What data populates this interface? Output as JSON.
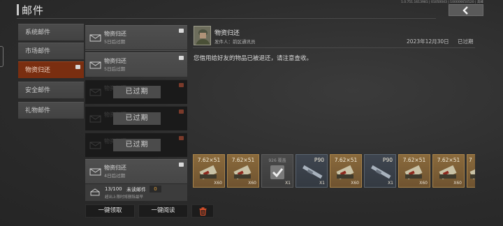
{
  "header": {
    "title": "邮件",
    "version": "1.0.751.1613981 | 01050043 | 100006650520 | 高峰"
  },
  "categories": [
    {
      "label": "系统邮件",
      "active": false
    },
    {
      "label": "市场邮件",
      "active": false
    },
    {
      "label": "物资归还",
      "active": true
    },
    {
      "label": "安全邮件",
      "active": false
    },
    {
      "label": "礼物邮件",
      "active": false
    }
  ],
  "mails": [
    {
      "title": "物资归还",
      "sub": "5日后过期",
      "expired": false
    },
    {
      "title": "物资归还",
      "sub": "5日后过期",
      "expired": false
    },
    {
      "title": "物资归还",
      "sub": "已过期",
      "expired": true,
      "tag": "已过期"
    },
    {
      "title": "物资归还",
      "sub": "已过期",
      "expired": true,
      "tag": "已过期"
    },
    {
      "title": "物资归还",
      "sub": "已过期",
      "expired": true,
      "tag": "已过期"
    },
    {
      "title": "物资归还",
      "sub": "4日后过期",
      "expired": false
    }
  ],
  "capacity": {
    "count": "13/100",
    "unread_label": "未读邮件",
    "unread": "0",
    "note": "超出上限时将删除最早"
  },
  "actions": {
    "collect_all": "一键领取",
    "read_all": "一键阅读"
  },
  "detail": {
    "subject": "物资归还",
    "sender": "发件人：前区通讯员",
    "date": "2023年12月30日",
    "status": "已过期",
    "body": "您借用给好友的物品已被退还，请注意查收。"
  },
  "items": [
    {
      "label": "7.62×51",
      "qty": "X60",
      "kind": "ammo"
    },
    {
      "label": "7.62×51",
      "qty": "X60",
      "kind": "ammo"
    },
    {
      "label": "926 覆盖",
      "qty": "X1",
      "kind": "claimed"
    },
    {
      "label": "P90",
      "qty": "X1",
      "kind": "gun"
    },
    {
      "label": "7.62×51",
      "qty": "X60",
      "kind": "ammo"
    },
    {
      "label": "P90",
      "qty": "X1",
      "kind": "gun"
    },
    {
      "label": "7.62×51",
      "qty": "X60",
      "kind": "ammo"
    },
    {
      "label": "7.62×51",
      "qty": "X60",
      "kind": "ammo"
    },
    {
      "label": "7",
      "qty": "",
      "kind": "ammo"
    }
  ],
  "colors": {
    "accent": "#7a2e10",
    "ammo_bg": "#8a6a3c",
    "gun_bg": "#3f4650",
    "unread_num": "#e8a33b"
  },
  "icons": [
    "back-arrow-icon",
    "envelope-icon",
    "trash-icon",
    "checkmark-icon",
    "ammo-box-icon",
    "rifle-icon",
    "mailbox-icon"
  ]
}
